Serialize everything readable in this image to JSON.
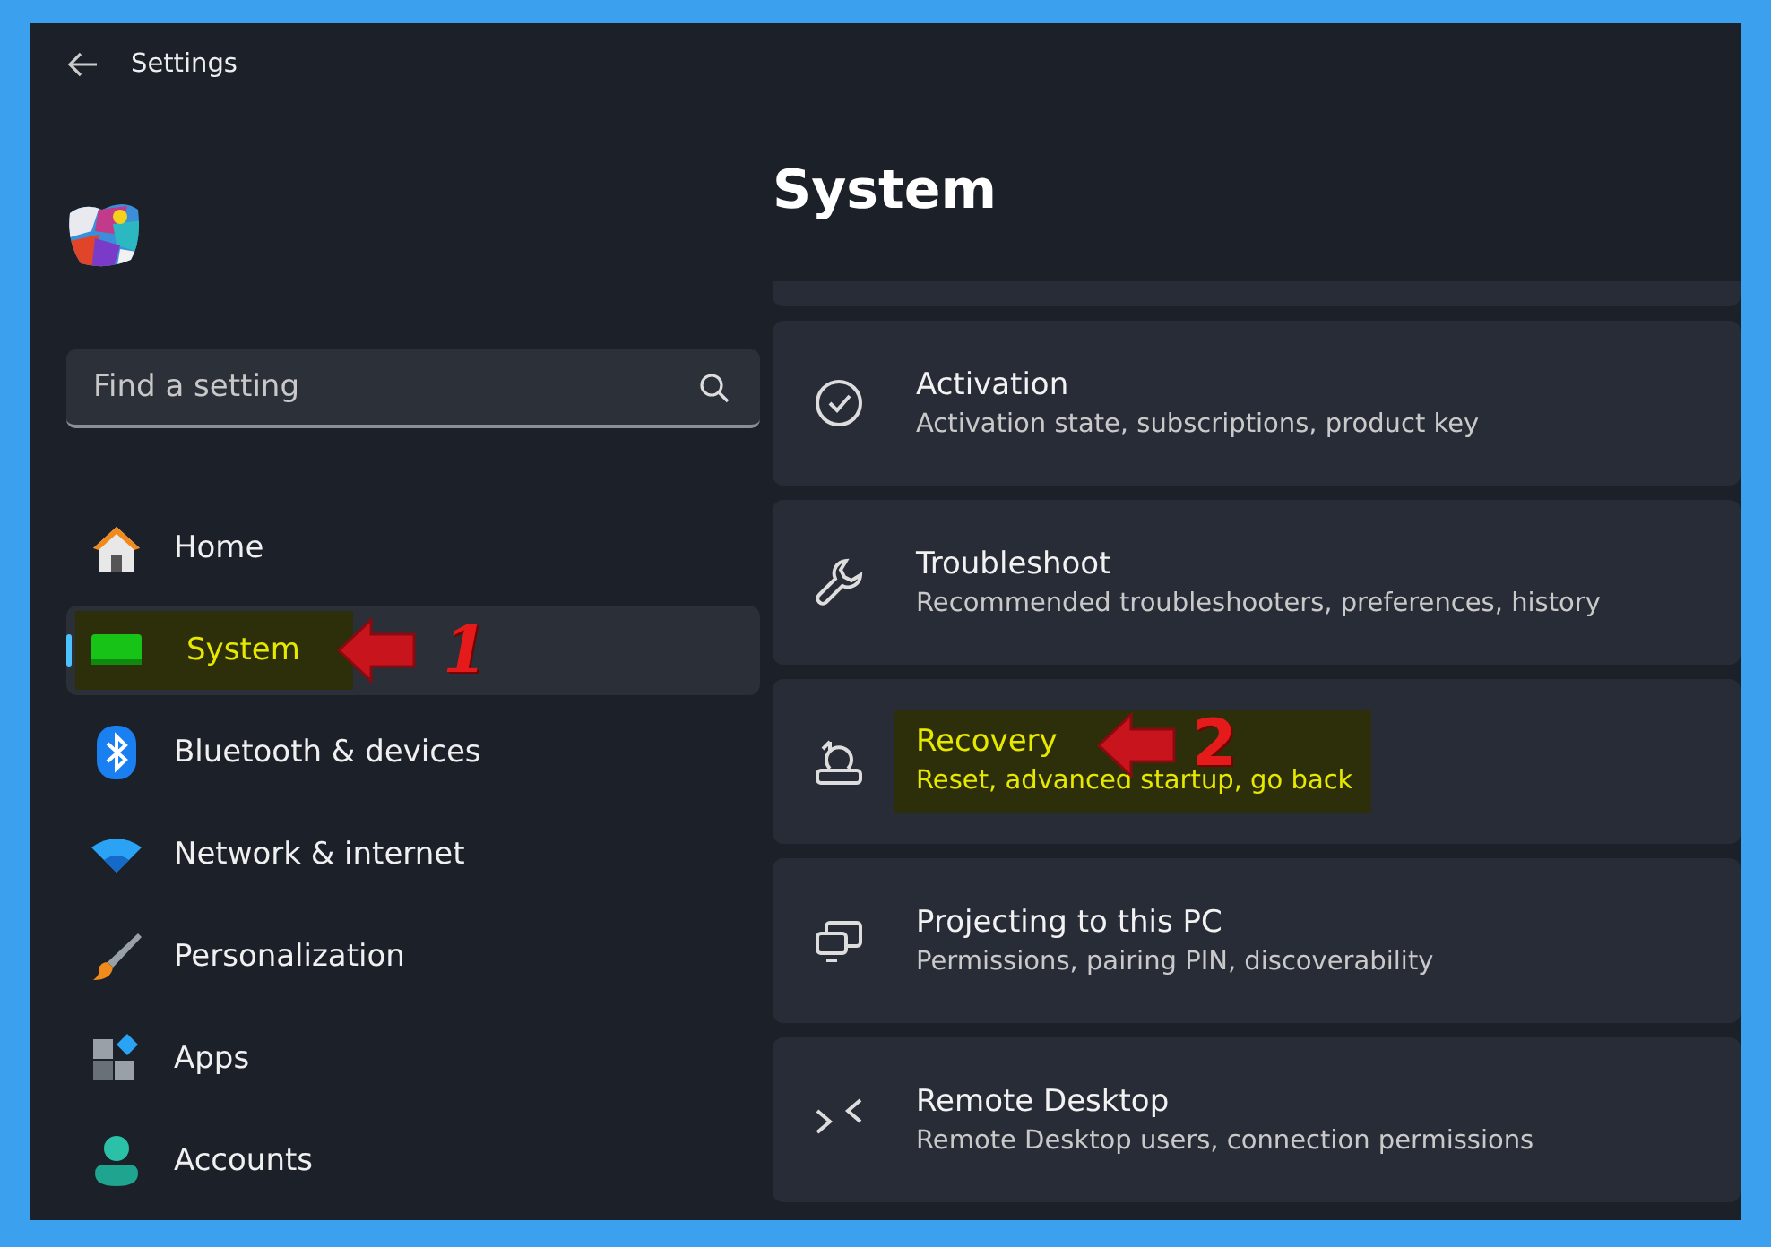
{
  "window": {
    "title": "Settings"
  },
  "search": {
    "placeholder": "Find a setting"
  },
  "sidebar": {
    "items": [
      {
        "label": "Home",
        "selected": false,
        "highlighted": false
      },
      {
        "label": "System",
        "selected": true,
        "highlighted": true,
        "callout": "1"
      },
      {
        "label": "Bluetooth & devices",
        "selected": false,
        "highlighted": false
      },
      {
        "label": "Network & internet",
        "selected": false,
        "highlighted": false
      },
      {
        "label": "Personalization",
        "selected": false,
        "highlighted": false
      },
      {
        "label": "Apps",
        "selected": false,
        "highlighted": false
      },
      {
        "label": "Accounts",
        "selected": false,
        "highlighted": false
      }
    ]
  },
  "page": {
    "title": "System"
  },
  "cards": [
    {
      "title": "Activation",
      "subtitle": "Activation state, subscriptions, product key",
      "highlighted": false
    },
    {
      "title": "Troubleshoot",
      "subtitle": "Recommended troubleshooters, preferences, history",
      "highlighted": false
    },
    {
      "title": "Recovery",
      "subtitle": "Reset, advanced startup, go back",
      "highlighted": true,
      "callout": "2"
    },
    {
      "title": "Projecting to this PC",
      "subtitle": "Permissions, pairing PIN, discoverability",
      "highlighted": false
    },
    {
      "title": "Remote Desktop",
      "subtitle": "Remote Desktop users, connection permissions",
      "highlighted": false
    }
  ]
}
